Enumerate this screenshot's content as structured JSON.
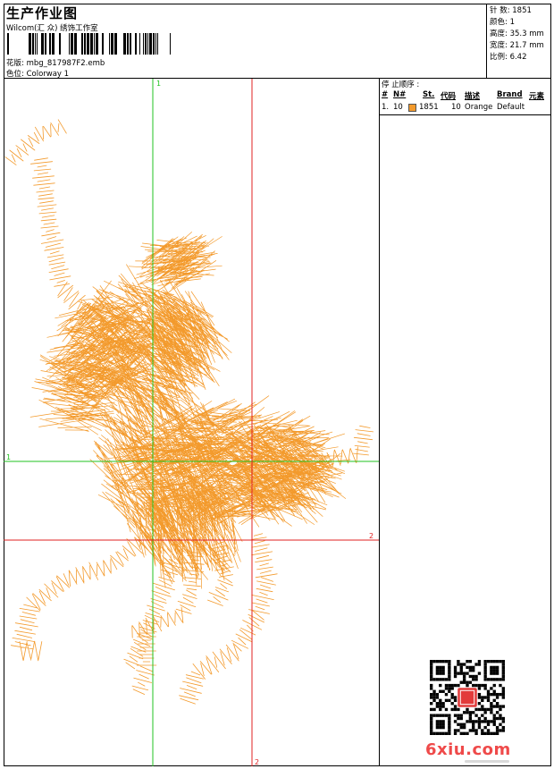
{
  "header": {
    "title": "生产作业图",
    "studio": "Wilcom(汇 众) 绣饰工作室",
    "design_label": "花版:",
    "design_file": "mbg_817987F2.emb",
    "colorway_label": "色位:",
    "colorway_value": "Colorway 1"
  },
  "stats": {
    "stitches": "针 数: 1851",
    "colors": "颜色: 1",
    "height": "高度: 35.3 mm",
    "width": "宽度: 21.7 mm",
    "scale": "比例: 6.42"
  },
  "sequence": {
    "title": "停 止顺序 :",
    "headers": [
      "#",
      "N#",
      "St.",
      "代码",
      "描述",
      "Brand",
      "元素"
    ],
    "rows": [
      {
        "index": "1.",
        "needle": "10",
        "stitches": "1851",
        "code": "10",
        "description": "Orange",
        "brand": "Default",
        "swatch": "#f39a2c"
      }
    ]
  },
  "canvas": {
    "thread_color": "#f39a2c",
    "guide1_color": "#22c322",
    "guide2_color": "#e02020",
    "guide1_top_label": "1",
    "guide1_left_label": "1",
    "guide2_right_label": "2",
    "guide2_bottom_label": "2"
  },
  "watermark": {
    "text": "6xiu.com",
    "color": "#ef4a4a"
  }
}
